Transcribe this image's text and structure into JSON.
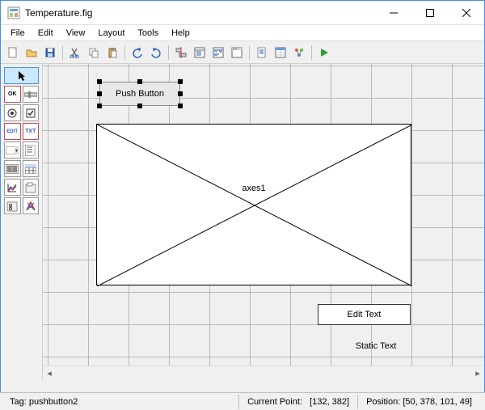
{
  "window": {
    "title": "Temperature.fig"
  },
  "menu": {
    "file": "File",
    "edit": "Edit",
    "view": "View",
    "layout": "Layout",
    "tools": "Tools",
    "help": "Help"
  },
  "palette_labels": {
    "ok": "OK",
    "edit": "EDIT",
    "txt": "TXT"
  },
  "canvas": {
    "push_button": "Push Button",
    "axes_label": "axes1",
    "edit_text": "Edit Text",
    "static_text": "Static Text"
  },
  "status": {
    "tag_label": "Tag:",
    "tag_value": "pushbutton2",
    "cp_label": "Current Point:",
    "cp_value": "[132, 382]",
    "pos_label": "Position:",
    "pos_value": "[50, 378, 101, 49]"
  }
}
